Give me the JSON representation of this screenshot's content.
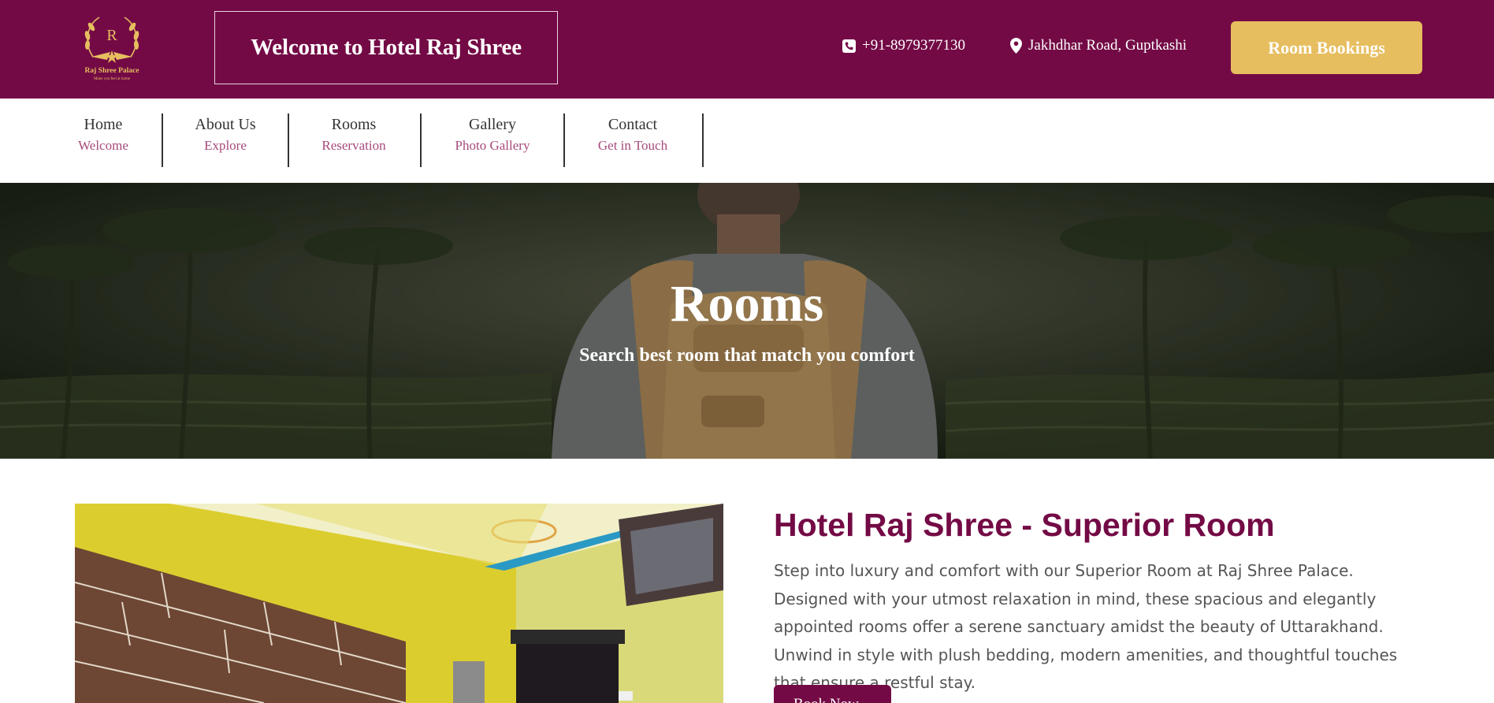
{
  "brand": {
    "logo_letter": "R",
    "logo_name": "Raj Shree Palace",
    "logo_tagline": "Make you feel at home"
  },
  "header": {
    "welcome": "Welcome to Hotel Raj Shree",
    "phone": "+91-8979377130",
    "address": "Jakhdhar Road, Guptkashi",
    "booking_button": "Room Bookings",
    "phone_icon": "phone-icon",
    "location_icon": "map-pin-icon"
  },
  "nav": {
    "items": [
      {
        "label": "Home",
        "sub": "Welcome"
      },
      {
        "label": "About Us",
        "sub": "Explore"
      },
      {
        "label": "Rooms",
        "sub": "Reservation"
      },
      {
        "label": "Gallery",
        "sub": "Photo Gallery"
      },
      {
        "label": "Contact",
        "sub": "Get in Touch"
      }
    ]
  },
  "hero": {
    "title": "Rooms",
    "subtitle": "Search best room that match you comfort"
  },
  "room": {
    "title": "Hotel Raj Shree - Superior Room",
    "description": "Step into luxury and comfort with our Superior Room at Raj Shree Palace. Designed with your utmost relaxation in mind, these spacious and elegantly appointed rooms offer a serene sanctuary amidst the beauty of Uttarakhand. Unwind in style with plush bedding, modern amenities, and thoughtful touches that ensure a restful stay.",
    "button": "Book Now"
  },
  "colors": {
    "brand_maroon": "#730a45",
    "gold": "#e6be5f",
    "nav_sub": "#a64a7c"
  }
}
